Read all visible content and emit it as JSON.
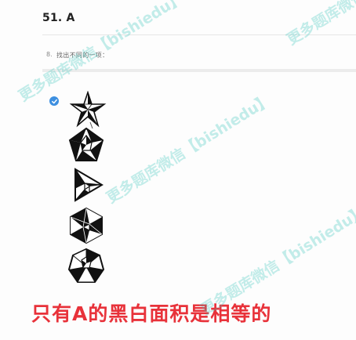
{
  "heading": "51. A",
  "question": {
    "number": "8.",
    "text": "找出不同的一项："
  },
  "options": {
    "selected_index": 0,
    "icons": [
      "star-figure-icon",
      "star-pentagon-figure-icon",
      "triangle-figure-icon",
      "hexagon-figure-icon",
      "heptagon-figure-icon"
    ]
  },
  "caption": "只有A的黑白面积是相等的",
  "watermark": "更多题库微信【bishiedu】",
  "colors": {
    "caption": "#e8323a",
    "check": "#3d8fe0",
    "watermark": "#3cc8be"
  }
}
